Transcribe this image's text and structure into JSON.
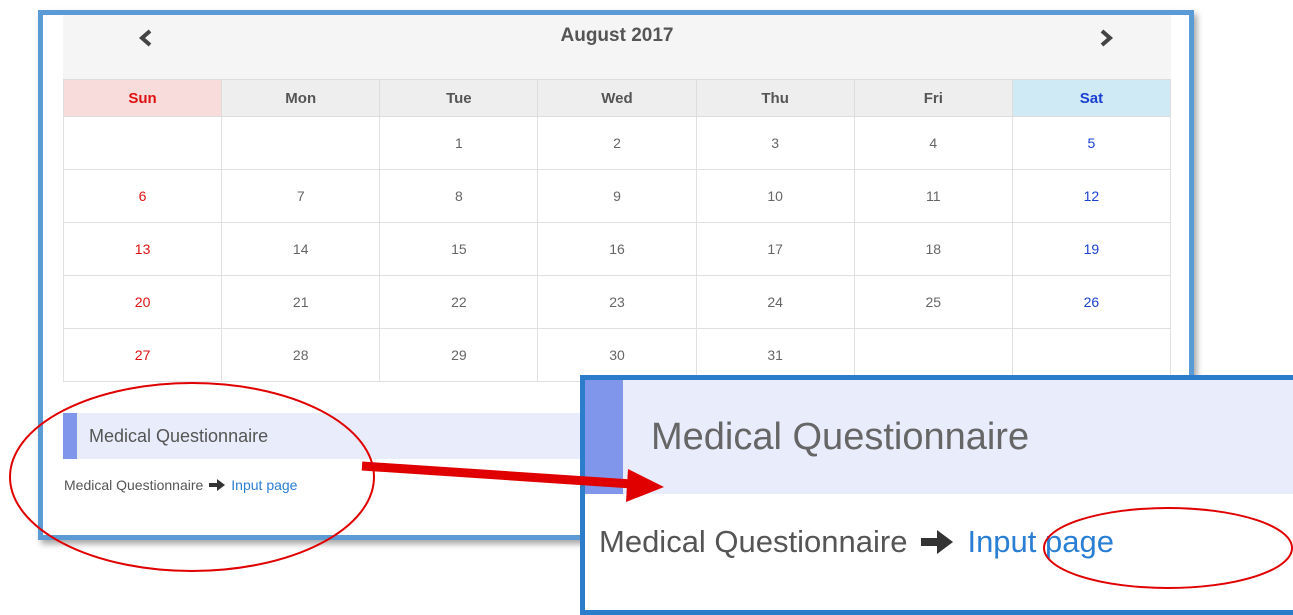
{
  "calendar": {
    "month_title": "August 2017",
    "weekdays": [
      "Sun",
      "Mon",
      "Tue",
      "Wed",
      "Thu",
      "Fri",
      "Sat"
    ],
    "weeks": [
      [
        "",
        "",
        "1",
        "2",
        "3",
        "4",
        "5"
      ],
      [
        "6",
        "7",
        "8",
        "9",
        "10",
        "11",
        "12"
      ],
      [
        "13",
        "14",
        "15",
        "16",
        "17",
        "18",
        "19"
      ],
      [
        "20",
        "21",
        "22",
        "23",
        "24",
        "25",
        "26"
      ],
      [
        "27",
        "28",
        "29",
        "30",
        "31",
        "",
        ""
      ]
    ]
  },
  "questionnaire": {
    "title": "Medical Questionnaire",
    "breadcrumb_text": "Medical Questionnaire",
    "link_label": "Input page"
  },
  "zoom": {
    "title": "Medical Questionnaire",
    "breadcrumb_text": "Medical Questionnaire",
    "link_label": "Input page"
  },
  "colors": {
    "frame_border": "#5b9bd5",
    "sunday": "#e01010",
    "saturday": "#1a3fd1",
    "link": "#2a7fd4",
    "annotation": "#e00000"
  },
  "icons": [
    "chevron-left-icon",
    "chevron-right-icon",
    "arrow-right-icon"
  ]
}
